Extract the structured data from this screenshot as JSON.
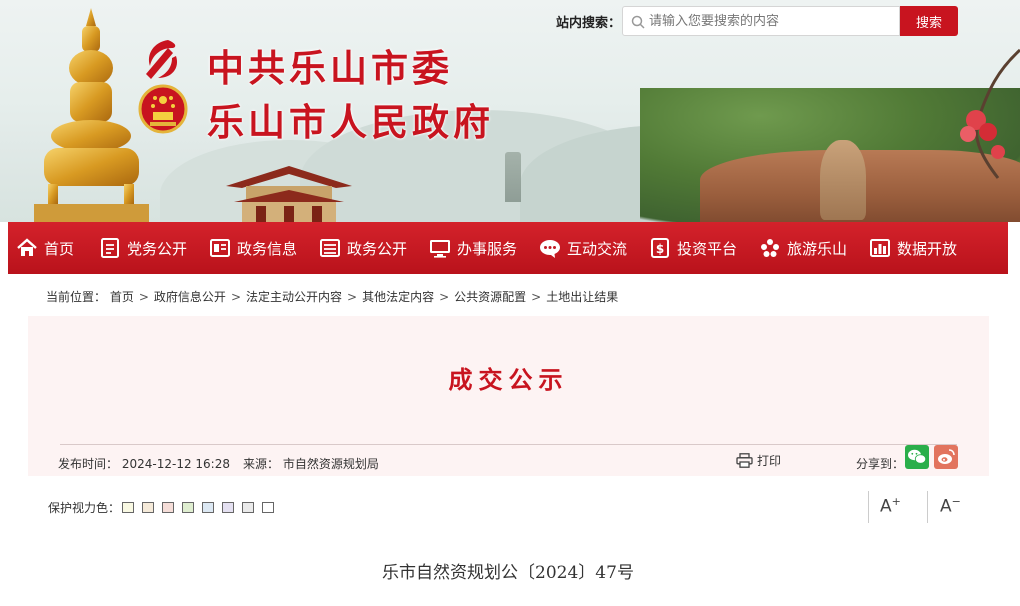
{
  "header": {
    "title_line1": "中共乐山市委",
    "title_line2": "乐山市人民政府",
    "search": {
      "label": "站内搜索：",
      "placeholder": "请输入您要搜索的内容",
      "button_label": "搜索"
    }
  },
  "nav": {
    "items": [
      {
        "label": "首页",
        "icon": "home-icon"
      },
      {
        "label": "党务公开",
        "icon": "party-doc-icon"
      },
      {
        "label": "政务信息",
        "icon": "info-board-icon"
      },
      {
        "label": "政务公开",
        "icon": "list-doc-icon"
      },
      {
        "label": "办事服务",
        "icon": "monitor-icon"
      },
      {
        "label": "互动交流",
        "icon": "chat-bubble-icon"
      },
      {
        "label": "投资平台",
        "icon": "money-icon"
      },
      {
        "label": "旅游乐山",
        "icon": "flower-icon"
      },
      {
        "label": "数据开放",
        "icon": "bar-chart-icon"
      }
    ]
  },
  "breadcrumb": {
    "prefix": "当前位置：",
    "items": [
      "首页",
      "政府信息公开",
      "法定主动公开内容",
      "其他法定内容",
      "公共资源配置",
      "土地出让结果"
    ],
    "separator": ">"
  },
  "article": {
    "title": "成交公示",
    "publish_label": "发布时间：",
    "publish_time": "2024-12-12 16:28",
    "source_label": "来源：",
    "source": "市自然资源规划局",
    "print_label": "打印",
    "share_label": "分享到：",
    "doc_number": "乐市自然资规划公〔2024〕47号"
  },
  "tools": {
    "eyecare_label": "保护视力色：",
    "eyecare_colors": [
      "#f9f9e3",
      "#f5ead9",
      "#f5ddd8",
      "#dfeed0",
      "#dce8f3",
      "#e4e0f1",
      "#eaeaea",
      "#ffffff"
    ],
    "font_increase": "A",
    "font_decrease": "A",
    "font_increase_sign": "+",
    "font_decrease_sign": "−"
  },
  "colors": {
    "brand_red": "#c8141f",
    "nav_red": "#c21a23",
    "head_bg": "#fdf3f3"
  }
}
